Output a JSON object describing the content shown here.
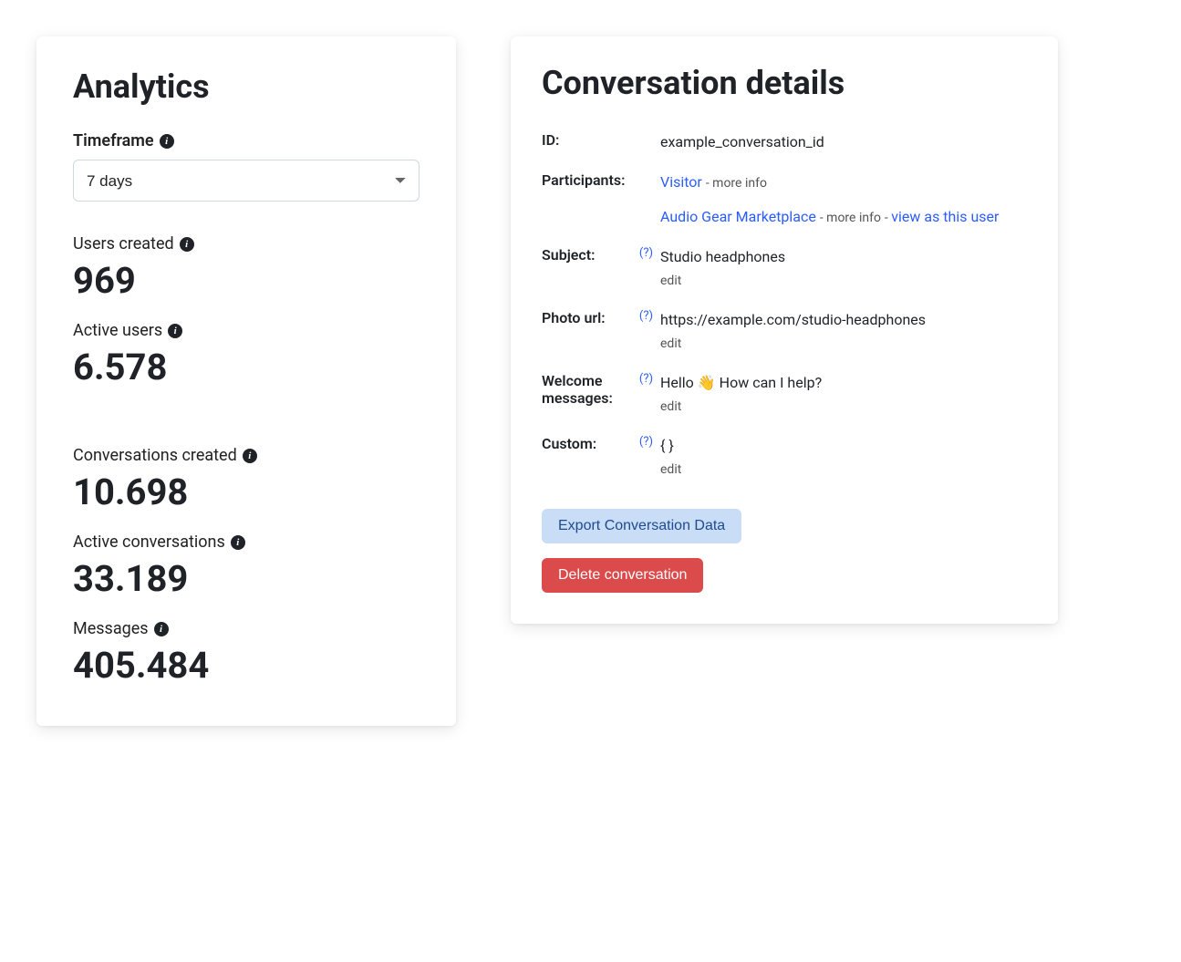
{
  "analytics": {
    "title": "Analytics",
    "timeframe_label": "Timeframe",
    "timeframe_value": "7 days",
    "metrics": {
      "users_created": {
        "label": "Users created",
        "value": "969"
      },
      "active_users": {
        "label": "Active users",
        "value": "6.578"
      },
      "conversations_created": {
        "label": "Conversations created",
        "value": "10.698"
      },
      "active_conversations": {
        "label": "Active conversations",
        "value": "33.189"
      },
      "messages": {
        "label": "Messages",
        "value": "405.484"
      }
    }
  },
  "details": {
    "title": "Conversation details",
    "id_label": "ID:",
    "id_value": "example_conversation_id",
    "participants_label": "Participants:",
    "participants": [
      {
        "name": "Visitor",
        "more_info": "more info",
        "view_as": null
      },
      {
        "name": "Audio Gear Marketplace",
        "more_info": "more info",
        "view_as": "view as this user"
      }
    ],
    "subject_label": "Subject:",
    "subject_value": "Studio headphones",
    "photo_label": "Photo url:",
    "photo_value": "https://example.com/studio-headphones",
    "welcome_label": "Welcome messages:",
    "welcome_value": "Hello 👋 How can I help?",
    "custom_label": "Custom:",
    "custom_value": "{  }",
    "edit": "edit",
    "help": "(?)",
    "sep": " - ",
    "export_button": "Export Conversation Data",
    "delete_button": "Delete conversation"
  }
}
